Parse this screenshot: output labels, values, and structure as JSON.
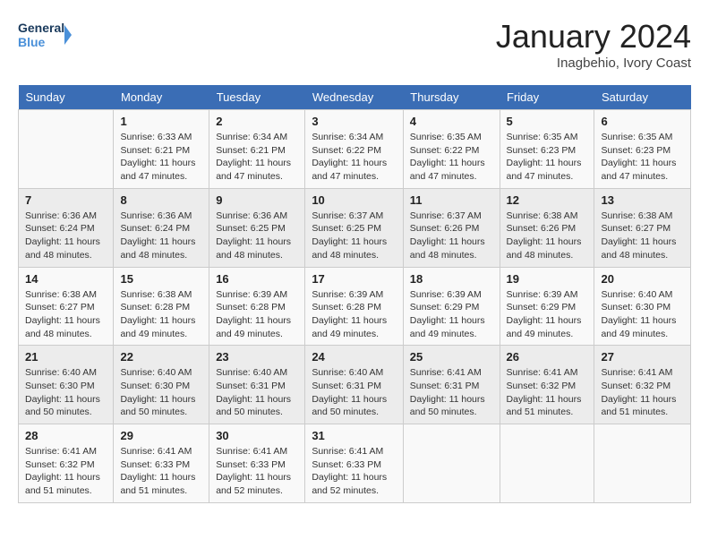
{
  "logo": {
    "line1": "General",
    "line2": "Blue"
  },
  "title": "January 2024",
  "subtitle": "Inagbehio, Ivory Coast",
  "weekdays": [
    "Sunday",
    "Monday",
    "Tuesday",
    "Wednesday",
    "Thursday",
    "Friday",
    "Saturday"
  ],
  "weeks": [
    [
      {
        "day": "",
        "sunrise": "",
        "sunset": "",
        "daylight": ""
      },
      {
        "day": "1",
        "sunrise": "Sunrise: 6:33 AM",
        "sunset": "Sunset: 6:21 PM",
        "daylight": "Daylight: 11 hours and 47 minutes."
      },
      {
        "day": "2",
        "sunrise": "Sunrise: 6:34 AM",
        "sunset": "Sunset: 6:21 PM",
        "daylight": "Daylight: 11 hours and 47 minutes."
      },
      {
        "day": "3",
        "sunrise": "Sunrise: 6:34 AM",
        "sunset": "Sunset: 6:22 PM",
        "daylight": "Daylight: 11 hours and 47 minutes."
      },
      {
        "day": "4",
        "sunrise": "Sunrise: 6:35 AM",
        "sunset": "Sunset: 6:22 PM",
        "daylight": "Daylight: 11 hours and 47 minutes."
      },
      {
        "day": "5",
        "sunrise": "Sunrise: 6:35 AM",
        "sunset": "Sunset: 6:23 PM",
        "daylight": "Daylight: 11 hours and 47 minutes."
      },
      {
        "day": "6",
        "sunrise": "Sunrise: 6:35 AM",
        "sunset": "Sunset: 6:23 PM",
        "daylight": "Daylight: 11 hours and 47 minutes."
      }
    ],
    [
      {
        "day": "7",
        "sunrise": "Sunrise: 6:36 AM",
        "sunset": "Sunset: 6:24 PM",
        "daylight": "Daylight: 11 hours and 48 minutes."
      },
      {
        "day": "8",
        "sunrise": "Sunrise: 6:36 AM",
        "sunset": "Sunset: 6:24 PM",
        "daylight": "Daylight: 11 hours and 48 minutes."
      },
      {
        "day": "9",
        "sunrise": "Sunrise: 6:36 AM",
        "sunset": "Sunset: 6:25 PM",
        "daylight": "Daylight: 11 hours and 48 minutes."
      },
      {
        "day": "10",
        "sunrise": "Sunrise: 6:37 AM",
        "sunset": "Sunset: 6:25 PM",
        "daylight": "Daylight: 11 hours and 48 minutes."
      },
      {
        "day": "11",
        "sunrise": "Sunrise: 6:37 AM",
        "sunset": "Sunset: 6:26 PM",
        "daylight": "Daylight: 11 hours and 48 minutes."
      },
      {
        "day": "12",
        "sunrise": "Sunrise: 6:38 AM",
        "sunset": "Sunset: 6:26 PM",
        "daylight": "Daylight: 11 hours and 48 minutes."
      },
      {
        "day": "13",
        "sunrise": "Sunrise: 6:38 AM",
        "sunset": "Sunset: 6:27 PM",
        "daylight": "Daylight: 11 hours and 48 minutes."
      }
    ],
    [
      {
        "day": "14",
        "sunrise": "Sunrise: 6:38 AM",
        "sunset": "Sunset: 6:27 PM",
        "daylight": "Daylight: 11 hours and 48 minutes."
      },
      {
        "day": "15",
        "sunrise": "Sunrise: 6:38 AM",
        "sunset": "Sunset: 6:28 PM",
        "daylight": "Daylight: 11 hours and 49 minutes."
      },
      {
        "day": "16",
        "sunrise": "Sunrise: 6:39 AM",
        "sunset": "Sunset: 6:28 PM",
        "daylight": "Daylight: 11 hours and 49 minutes."
      },
      {
        "day": "17",
        "sunrise": "Sunrise: 6:39 AM",
        "sunset": "Sunset: 6:28 PM",
        "daylight": "Daylight: 11 hours and 49 minutes."
      },
      {
        "day": "18",
        "sunrise": "Sunrise: 6:39 AM",
        "sunset": "Sunset: 6:29 PM",
        "daylight": "Daylight: 11 hours and 49 minutes."
      },
      {
        "day": "19",
        "sunrise": "Sunrise: 6:39 AM",
        "sunset": "Sunset: 6:29 PM",
        "daylight": "Daylight: 11 hours and 49 minutes."
      },
      {
        "day": "20",
        "sunrise": "Sunrise: 6:40 AM",
        "sunset": "Sunset: 6:30 PM",
        "daylight": "Daylight: 11 hours and 49 minutes."
      }
    ],
    [
      {
        "day": "21",
        "sunrise": "Sunrise: 6:40 AM",
        "sunset": "Sunset: 6:30 PM",
        "daylight": "Daylight: 11 hours and 50 minutes."
      },
      {
        "day": "22",
        "sunrise": "Sunrise: 6:40 AM",
        "sunset": "Sunset: 6:30 PM",
        "daylight": "Daylight: 11 hours and 50 minutes."
      },
      {
        "day": "23",
        "sunrise": "Sunrise: 6:40 AM",
        "sunset": "Sunset: 6:31 PM",
        "daylight": "Daylight: 11 hours and 50 minutes."
      },
      {
        "day": "24",
        "sunrise": "Sunrise: 6:40 AM",
        "sunset": "Sunset: 6:31 PM",
        "daylight": "Daylight: 11 hours and 50 minutes."
      },
      {
        "day": "25",
        "sunrise": "Sunrise: 6:41 AM",
        "sunset": "Sunset: 6:31 PM",
        "daylight": "Daylight: 11 hours and 50 minutes."
      },
      {
        "day": "26",
        "sunrise": "Sunrise: 6:41 AM",
        "sunset": "Sunset: 6:32 PM",
        "daylight": "Daylight: 11 hours and 51 minutes."
      },
      {
        "day": "27",
        "sunrise": "Sunrise: 6:41 AM",
        "sunset": "Sunset: 6:32 PM",
        "daylight": "Daylight: 11 hours and 51 minutes."
      }
    ],
    [
      {
        "day": "28",
        "sunrise": "Sunrise: 6:41 AM",
        "sunset": "Sunset: 6:32 PM",
        "daylight": "Daylight: 11 hours and 51 minutes."
      },
      {
        "day": "29",
        "sunrise": "Sunrise: 6:41 AM",
        "sunset": "Sunset: 6:33 PM",
        "daylight": "Daylight: 11 hours and 51 minutes."
      },
      {
        "day": "30",
        "sunrise": "Sunrise: 6:41 AM",
        "sunset": "Sunset: 6:33 PM",
        "daylight": "Daylight: 11 hours and 52 minutes."
      },
      {
        "day": "31",
        "sunrise": "Sunrise: 6:41 AM",
        "sunset": "Sunset: 6:33 PM",
        "daylight": "Daylight: 11 hours and 52 minutes."
      },
      {
        "day": "",
        "sunrise": "",
        "sunset": "",
        "daylight": ""
      },
      {
        "day": "",
        "sunrise": "",
        "sunset": "",
        "daylight": ""
      },
      {
        "day": "",
        "sunrise": "",
        "sunset": "",
        "daylight": ""
      }
    ]
  ]
}
